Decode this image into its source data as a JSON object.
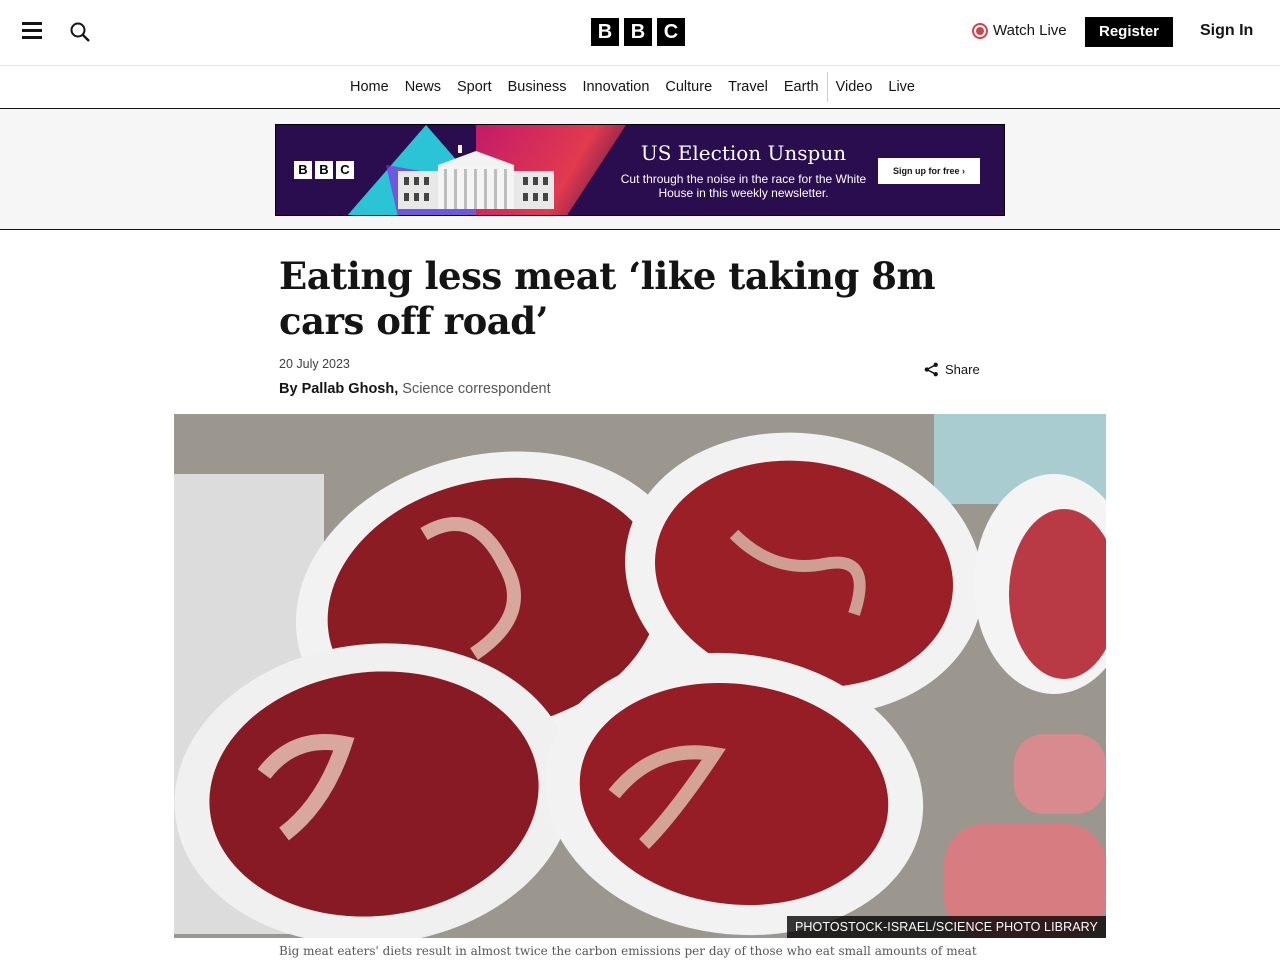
{
  "header": {
    "logo_letters": [
      "B",
      "B",
      "C"
    ],
    "watch_live": "Watch Live",
    "register": "Register",
    "sign_in": "Sign In"
  },
  "nav": {
    "items": [
      "Home",
      "News",
      "Sport",
      "Business",
      "Innovation",
      "Culture",
      "Travel",
      "Earth",
      "Video",
      "Live"
    ]
  },
  "banner": {
    "logo_letters": [
      "B",
      "B",
      "C"
    ],
    "title": "US Election Unspun",
    "subtitle": "Cut through the noise in the race for the White House in this weekly newsletter.",
    "cta": "Sign up for free ›"
  },
  "article": {
    "headline": "Eating less meat ‘like taking 8m cars off road’",
    "date": "20 July 2023",
    "author": "By Pallab Ghosh,",
    "role": "Science correspondent",
    "share": "Share",
    "image_credit": "PHOTOSTOCK-ISRAEL/SCIENCE PHOTO LIBRARY",
    "caption": "Big meat eaters' diets result in almost twice the carbon emissions per day of those who eat small amounts of meat"
  }
}
